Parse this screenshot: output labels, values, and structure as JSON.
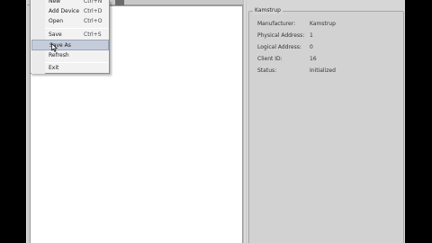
{
  "file_menu": {
    "items": [
      {
        "label": "New",
        "shortcut": "Ctrl+N"
      },
      {
        "label": "Add Device",
        "shortcut": "Ctrl+D"
      },
      {
        "label": "Open",
        "shortcut": "Ctrl+O"
      },
      {
        "label": "Save",
        "shortcut": "Ctrl+S"
      },
      {
        "label": "Save As",
        "shortcut": ""
      },
      {
        "label": "Refresh",
        "shortcut": ""
      },
      {
        "label": "Exit",
        "shortcut": ""
      }
    ],
    "highlighted": "Save As"
  },
  "details": {
    "group_title": "Kamstrup",
    "properties": [
      {
        "label": "Manufacturer:",
        "value": "Kamstrup"
      },
      {
        "label": "Physical Address:",
        "value": "1"
      },
      {
        "label": "Logical Address:",
        "value": "0"
      },
      {
        "label": "Client ID:",
        "value": "16"
      },
      {
        "label": "Status:",
        "value": "Initialized"
      }
    ]
  },
  "colors": {
    "menu_highlight": "#c6cdda",
    "window_background": "#c9c9c9"
  }
}
